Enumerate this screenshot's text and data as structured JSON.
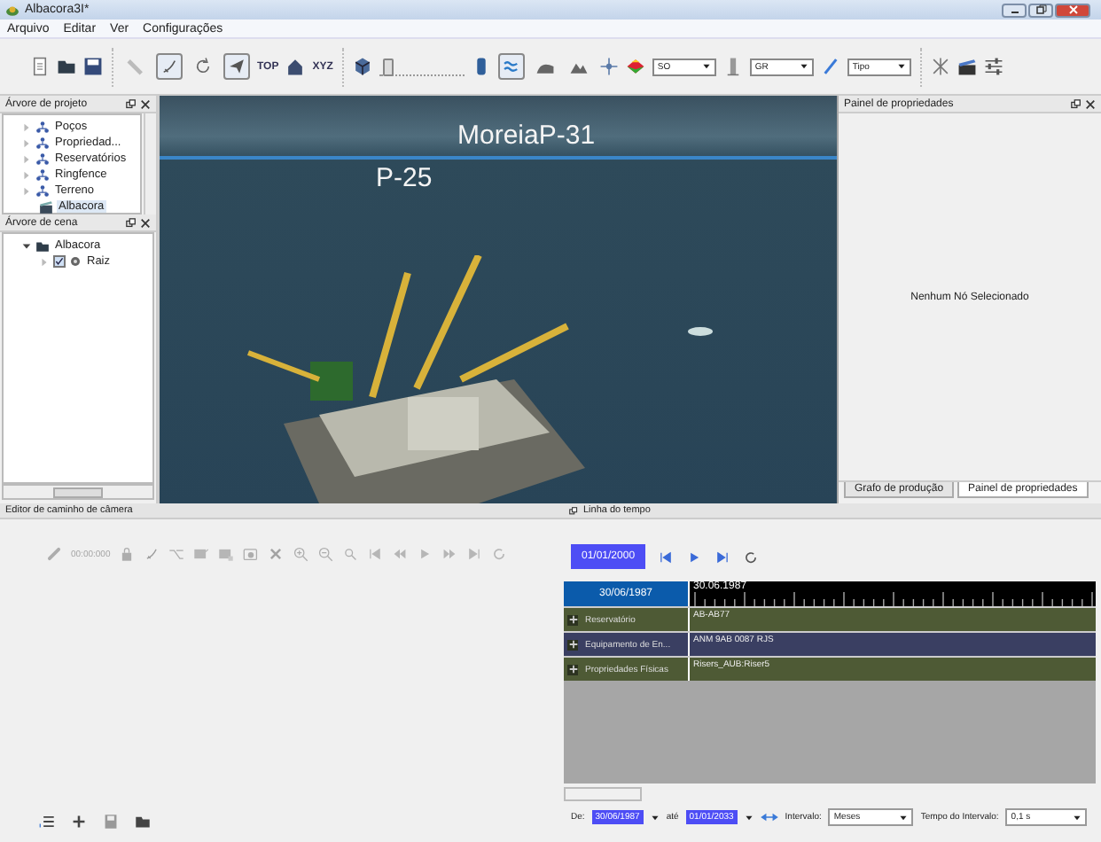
{
  "window": {
    "title": "Albacora3I*"
  },
  "menu": [
    "Arquivo",
    "Editar",
    "Ver",
    "Configurações"
  ],
  "toolbar": {
    "groups": [
      [
        {
          "kind": "new"
        },
        {
          "kind": "open"
        },
        {
          "kind": "save"
        }
      ],
      [
        {
          "kind": "ruler",
          "pressed": false
        },
        {
          "kind": "cursor",
          "pressed": true
        },
        {
          "kind": "rotate",
          "pressed": false
        },
        {
          "kind": "plane",
          "pressed": true
        },
        {
          "kind": "text",
          "label": "TOP"
        },
        {
          "kind": "home"
        },
        {
          "kind": "text",
          "label": "XYZ"
        }
      ],
      [
        {
          "kind": "cube"
        },
        {
          "kind": "slider",
          "level": 0.04
        },
        {
          "kind": "cylinder"
        },
        {
          "kind": "waves",
          "pressed": true
        },
        {
          "kind": "hill",
          "pressed": false
        },
        {
          "kind": "mountain",
          "pressed": false
        },
        {
          "kind": "star"
        },
        {
          "kind": "colormap"
        },
        {
          "kind": "dropdown",
          "value": "SO"
        },
        {
          "kind": "tower"
        },
        {
          "kind": "dropdown",
          "value": "GR"
        },
        {
          "kind": "pen"
        },
        {
          "kind": "dropdown",
          "value": "Tipo"
        }
      ],
      [
        {
          "kind": "network"
        },
        {
          "kind": "clapboard"
        },
        {
          "kind": "sliders"
        }
      ]
    ]
  },
  "project_tree": {
    "title": "Árvore de projeto",
    "items": [
      {
        "label": "Poços",
        "expanded": false,
        "selected": false
      },
      {
        "label": "Propriedad...",
        "expanded": false,
        "selected": false
      },
      {
        "label": "Reservatórios",
        "expanded": false,
        "selected": false
      },
      {
        "label": "Ringfence",
        "expanded": false,
        "selected": false
      },
      {
        "label": "Terreno",
        "expanded": false,
        "selected": false
      },
      {
        "label": "Albacora",
        "kind": "leaf",
        "selected": true
      }
    ]
  },
  "scene_tree": {
    "title": "Árvore de cena",
    "items": [
      {
        "label": "Albacora",
        "expanded": true,
        "children": [
          {
            "label": "Raiz",
            "expanded": false,
            "checked": true
          }
        ]
      }
    ]
  },
  "viewport": {
    "labels": [
      "MoreiaP-31",
      "P-25"
    ]
  },
  "properties_panel": {
    "title": "Painel de propriedades",
    "message": "Nenhum Nó Selecionado",
    "tabs": [
      {
        "label": "Grafo de produção",
        "selected": false
      },
      {
        "label": "Painel de propriedades",
        "selected": true
      }
    ]
  },
  "camera_editor": {
    "title": "Editor de caminho de câmera",
    "time": "00:00:000",
    "controls_disabled": true
  },
  "timeline": {
    "title": "Linha do tempo",
    "current_date": "01/01/2000",
    "header_date": "30/06/1987",
    "ruler_label": "30.06.1987",
    "tracks": [
      {
        "label": "Reservatório",
        "value": "AB-AB77",
        "color": "#4e5a35"
      },
      {
        "label": "Equipamento de En...",
        "value": "ANM 9AB  0087  RJS",
        "color": "#3a3f62"
      },
      {
        "label": "Propriedades Físicas",
        "value": "Risers_AUB:Riser5",
        "color": "#4e5a35"
      }
    ],
    "footer": {
      "from_label": "De:",
      "from": "30/06/1987",
      "to_label": "até",
      "to": "01/01/2033",
      "interval_label": "Intervalo:",
      "interval": "Meses",
      "step_label": "Tempo do Intervalo:",
      "step": "0,1 s"
    }
  }
}
